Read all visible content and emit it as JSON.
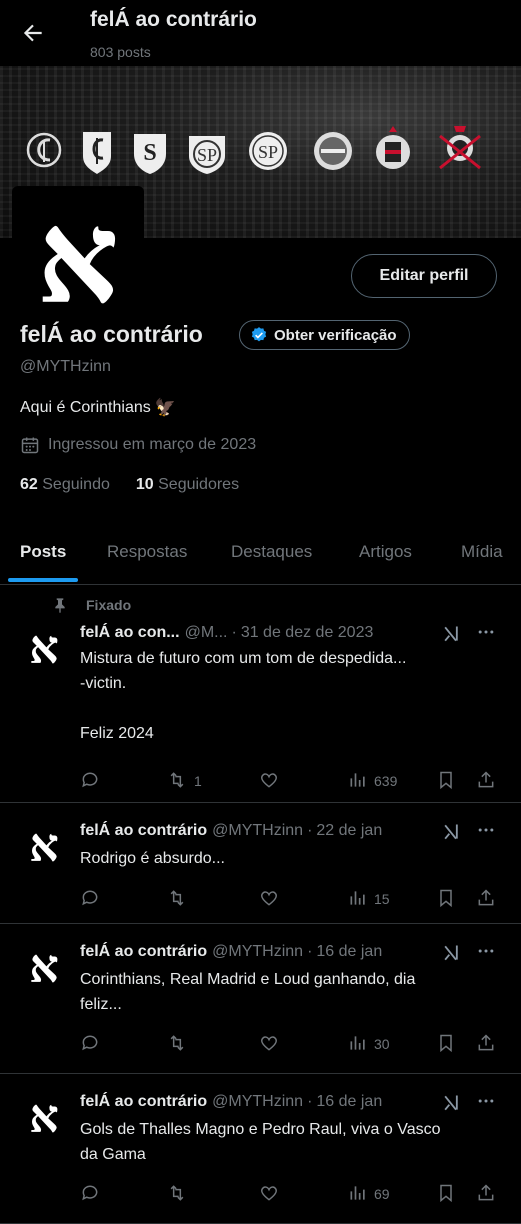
{
  "header": {
    "back_icon": "arrow-left-icon",
    "title": "felÁ ao contrário",
    "posts_count": "803 posts"
  },
  "banner": {
    "description_icons": [
      "club-crest-icon",
      "club-crest-icon",
      "club-crest-icon",
      "club-crest-icon",
      "club-crest-icon",
      "club-crest-icon",
      "club-crest-icon",
      "club-crest-icon"
    ]
  },
  "profile": {
    "avatar_glyph": "א",
    "edit_label": "Editar perfil",
    "name": "felÁ ao contrário",
    "verify_label": "Obter verificação",
    "handle": "@MYTHzinn",
    "bio": "Aqui é Corinthians",
    "bio_emoji": "🦅",
    "joined": "Ingressou em março de 2023",
    "following_count": "62",
    "following_label": "Seguindo",
    "followers_count": "10",
    "followers_label": "Seguidores"
  },
  "tabs": [
    "Posts",
    "Respostas",
    "Destaques",
    "Artigos",
    "Mídia"
  ],
  "colors": {
    "accent": "#1d9bf0",
    "muted": "#71767b",
    "text": "#e7e9ea",
    "border": "#2f3336"
  },
  "pinned_label": "Fixado",
  "tweets": [
    {
      "name": "felÁ ao con...",
      "handle": "@M...",
      "date": "31 de dez de 2023",
      "text": "Mistura de futuro com um tom de despedida...\n-victin.\n\nFeliz 2024",
      "retweets": "1",
      "views": "639"
    },
    {
      "name": "felÁ ao contrário",
      "handle": "@MYTHzinn",
      "date": "22 de jan",
      "text": "Rodrigo é absurdo...",
      "retweets": "",
      "views": "15"
    },
    {
      "name": "felÁ ao contrário",
      "handle": "@MYTHzinn",
      "date": "16 de jan",
      "text": "Corinthians, Real Madrid e Loud ganhando, dia\nfeliz...",
      "retweets": "",
      "views": "30"
    },
    {
      "name": "felÁ ao contrário",
      "handle": "@MYTHzinn",
      "date": "16 de jan",
      "text": "Gols de Thalles Magno e Pedro Raul, viva o Vasco\nda Gama",
      "retweets": "",
      "views": "69"
    }
  ]
}
